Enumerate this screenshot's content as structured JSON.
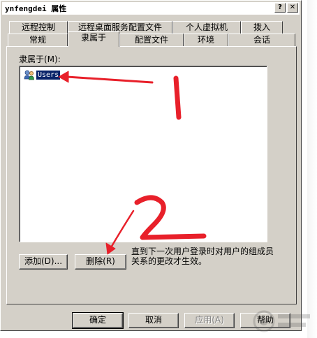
{
  "window": {
    "title": "ynfengdei 属性",
    "help_glyph": "?",
    "close_glyph": "✕"
  },
  "tabs_back": [
    {
      "label": "远程控制"
    },
    {
      "label": "远程桌面服务配置文件"
    },
    {
      "label": "个人虚拟机"
    },
    {
      "label": "拨入"
    }
  ],
  "tabs_front": [
    {
      "label": "常规"
    },
    {
      "label": "隶属于",
      "active": true
    },
    {
      "label": "配置文件"
    },
    {
      "label": "环境"
    },
    {
      "label": "会话"
    }
  ],
  "member_of": {
    "label": "隶属于(M):",
    "items": [
      {
        "name": "Users",
        "icon": "group-icon",
        "selected": true
      }
    ]
  },
  "actions": {
    "add_label": "添加(D)...",
    "remove_label": "删除(R)",
    "hint": "直到下一次用户登录时对用户的组成员关系的更改才生效。"
  },
  "footer": {
    "ok_label": "确定",
    "cancel_label": "取消",
    "apply_label": "应用(A)",
    "help_label": "帮助"
  },
  "annotations": {
    "mark_1": "1",
    "mark_2": "2",
    "color": "#e8202a"
  }
}
